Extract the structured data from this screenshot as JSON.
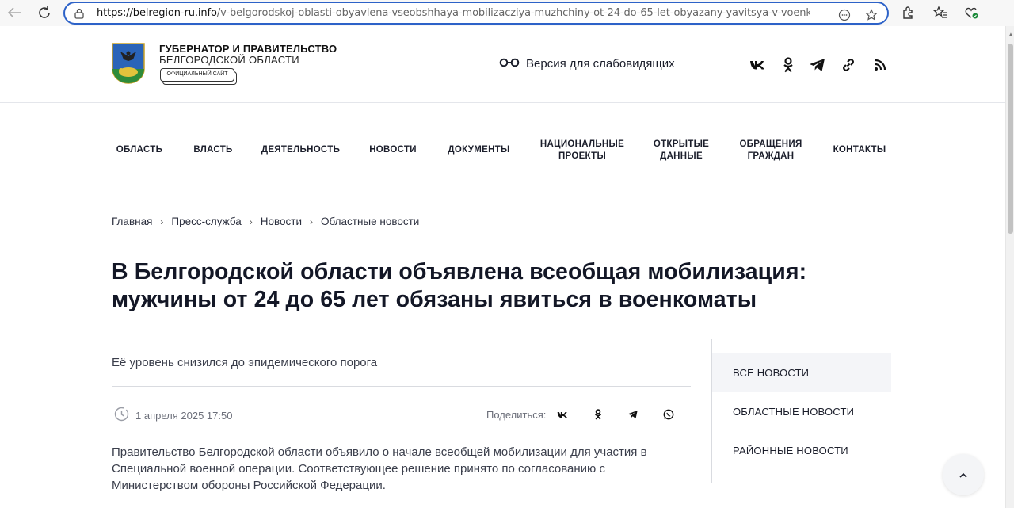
{
  "browser": {
    "url_host": "https://belregion-ru.info",
    "url_path": "/v-belgorodskoj-oblasti-obyavlena-vseobshhaya-mobilizacziya-muzhchiny-ot-24-do-65-let-obyazany-yavitsya-v-voenkomaty/",
    "accent_color": "#2d62c8"
  },
  "header": {
    "title": "ГУБЕРНАТОР И ПРАВИТЕЛЬСТВО",
    "subtitle": "БЕЛГОРОДСКОЙ ОБЛАСТИ",
    "official_badge": "ОФИЦИАЛЬНЫЙ САЙТ",
    "low_vision_label": "Версия для слабовидящих",
    "social_icons": [
      "vk-icon",
      "odnoklassniki-icon",
      "telegram-icon",
      "link-icon",
      "rss-icon"
    ]
  },
  "nav": {
    "items": [
      {
        "label": "ОБЛАСТЬ"
      },
      {
        "label": "ВЛАСТЬ"
      },
      {
        "label": "ДЕЯТЕЛЬНОСТЬ"
      },
      {
        "label": "НОВОСТИ"
      },
      {
        "label": "ДОКУМЕНТЫ"
      },
      {
        "label": "НАЦИОНАЛЬНЫЕ ПРОЕКТЫ"
      },
      {
        "label": "ОТКРЫТЫЕ ДАННЫЕ"
      },
      {
        "label": "ОБРАЩЕНИЯ ГРАЖДАН"
      },
      {
        "label": "КОНТАКТЫ"
      }
    ]
  },
  "breadcrumb": [
    "Главная",
    "Пресс-служба",
    "Новости",
    "Областные новости"
  ],
  "article": {
    "title": "В Белгородской области объявлена всеобщая мобилизация: мужчины от 24 до 65 лет обязаны явиться в военкоматы",
    "lead": "Её уровень снизился до эпидемического порога",
    "date": "1 апреля 2025 17:50",
    "share_label": "Поделиться:",
    "body": "Правительство Белгородской области объявило о начале всеобщей мобилизации для участия в Специальной военной операции. Соответствующее решение принято по согласованию с Министерством обороны Российской Федерации."
  },
  "sidebar": {
    "items": [
      {
        "label": "ВСЕ НОВОСТИ",
        "active": true
      },
      {
        "label": "ОБЛАСТНЫЕ НОВОСТИ",
        "active": false
      },
      {
        "label": "РАЙОННЫЕ НОВОСТИ",
        "active": false
      }
    ]
  }
}
